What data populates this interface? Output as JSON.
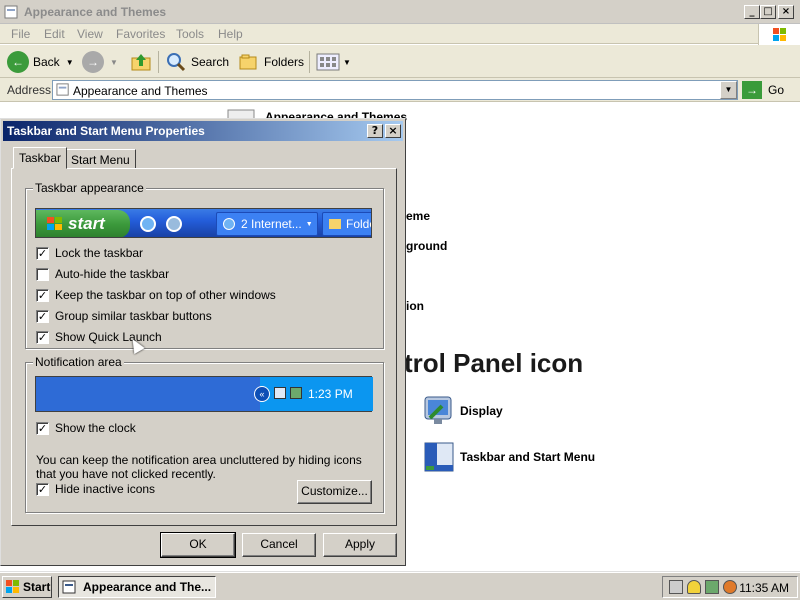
{
  "window": {
    "title": "Appearance and Themes",
    "menu": [
      "File",
      "Edit",
      "View",
      "Favorites",
      "Tools",
      "Help"
    ],
    "toolbar": {
      "back": "Back",
      "search": "Search",
      "folders": "Folders"
    },
    "address": {
      "label": "Address",
      "value": "Appearance and Themes",
      "go": "Go"
    }
  },
  "content": {
    "partial_header": "Appearance and Themes",
    "partial_items": [
      "eme",
      "ground",
      "ion"
    ],
    "heading_partial": "trol Panel icon",
    "icons": [
      {
        "label": "Display",
        "icon": "display-icon"
      },
      {
        "label": "Taskbar and Start Menu",
        "icon": "taskbar-start-menu-icon"
      }
    ]
  },
  "dialog": {
    "title": "Taskbar and Start Menu Properties",
    "tabs": [
      "Taskbar",
      "Start Menu"
    ],
    "taskbar_group": {
      "label": "Taskbar appearance",
      "preview": {
        "start": "start",
        "task1": "2 Internet...",
        "task2": "Folde"
      },
      "options": [
        {
          "label": "Lock the taskbar",
          "checked": true
        },
        {
          "label": "Auto-hide the taskbar",
          "checked": false
        },
        {
          "label": "Keep the taskbar on top of other windows",
          "checked": true
        },
        {
          "label": "Group similar taskbar buttons",
          "checked": true
        },
        {
          "label": "Show Quick Launch",
          "checked": true
        }
      ]
    },
    "notification_group": {
      "label": "Notification area",
      "preview_time": "1:23 PM",
      "show_clock": {
        "label": "Show the clock",
        "checked": true
      },
      "note": "You can keep the notification area uncluttered by hiding icons that you have not clicked recently.",
      "hide_inactive": {
        "label": "Hide inactive icons",
        "checked": true
      },
      "customize": "Customize..."
    },
    "buttons": {
      "ok": "OK",
      "cancel": "Cancel",
      "apply": "Apply"
    }
  },
  "taskbar": {
    "start": "Start",
    "task": "Appearance and The...",
    "clock": "11:35 AM"
  },
  "colors": {
    "title_gradient_start": "#0a246a",
    "title_gradient_end": "#a6caf0",
    "face": "#d4d0c8"
  }
}
